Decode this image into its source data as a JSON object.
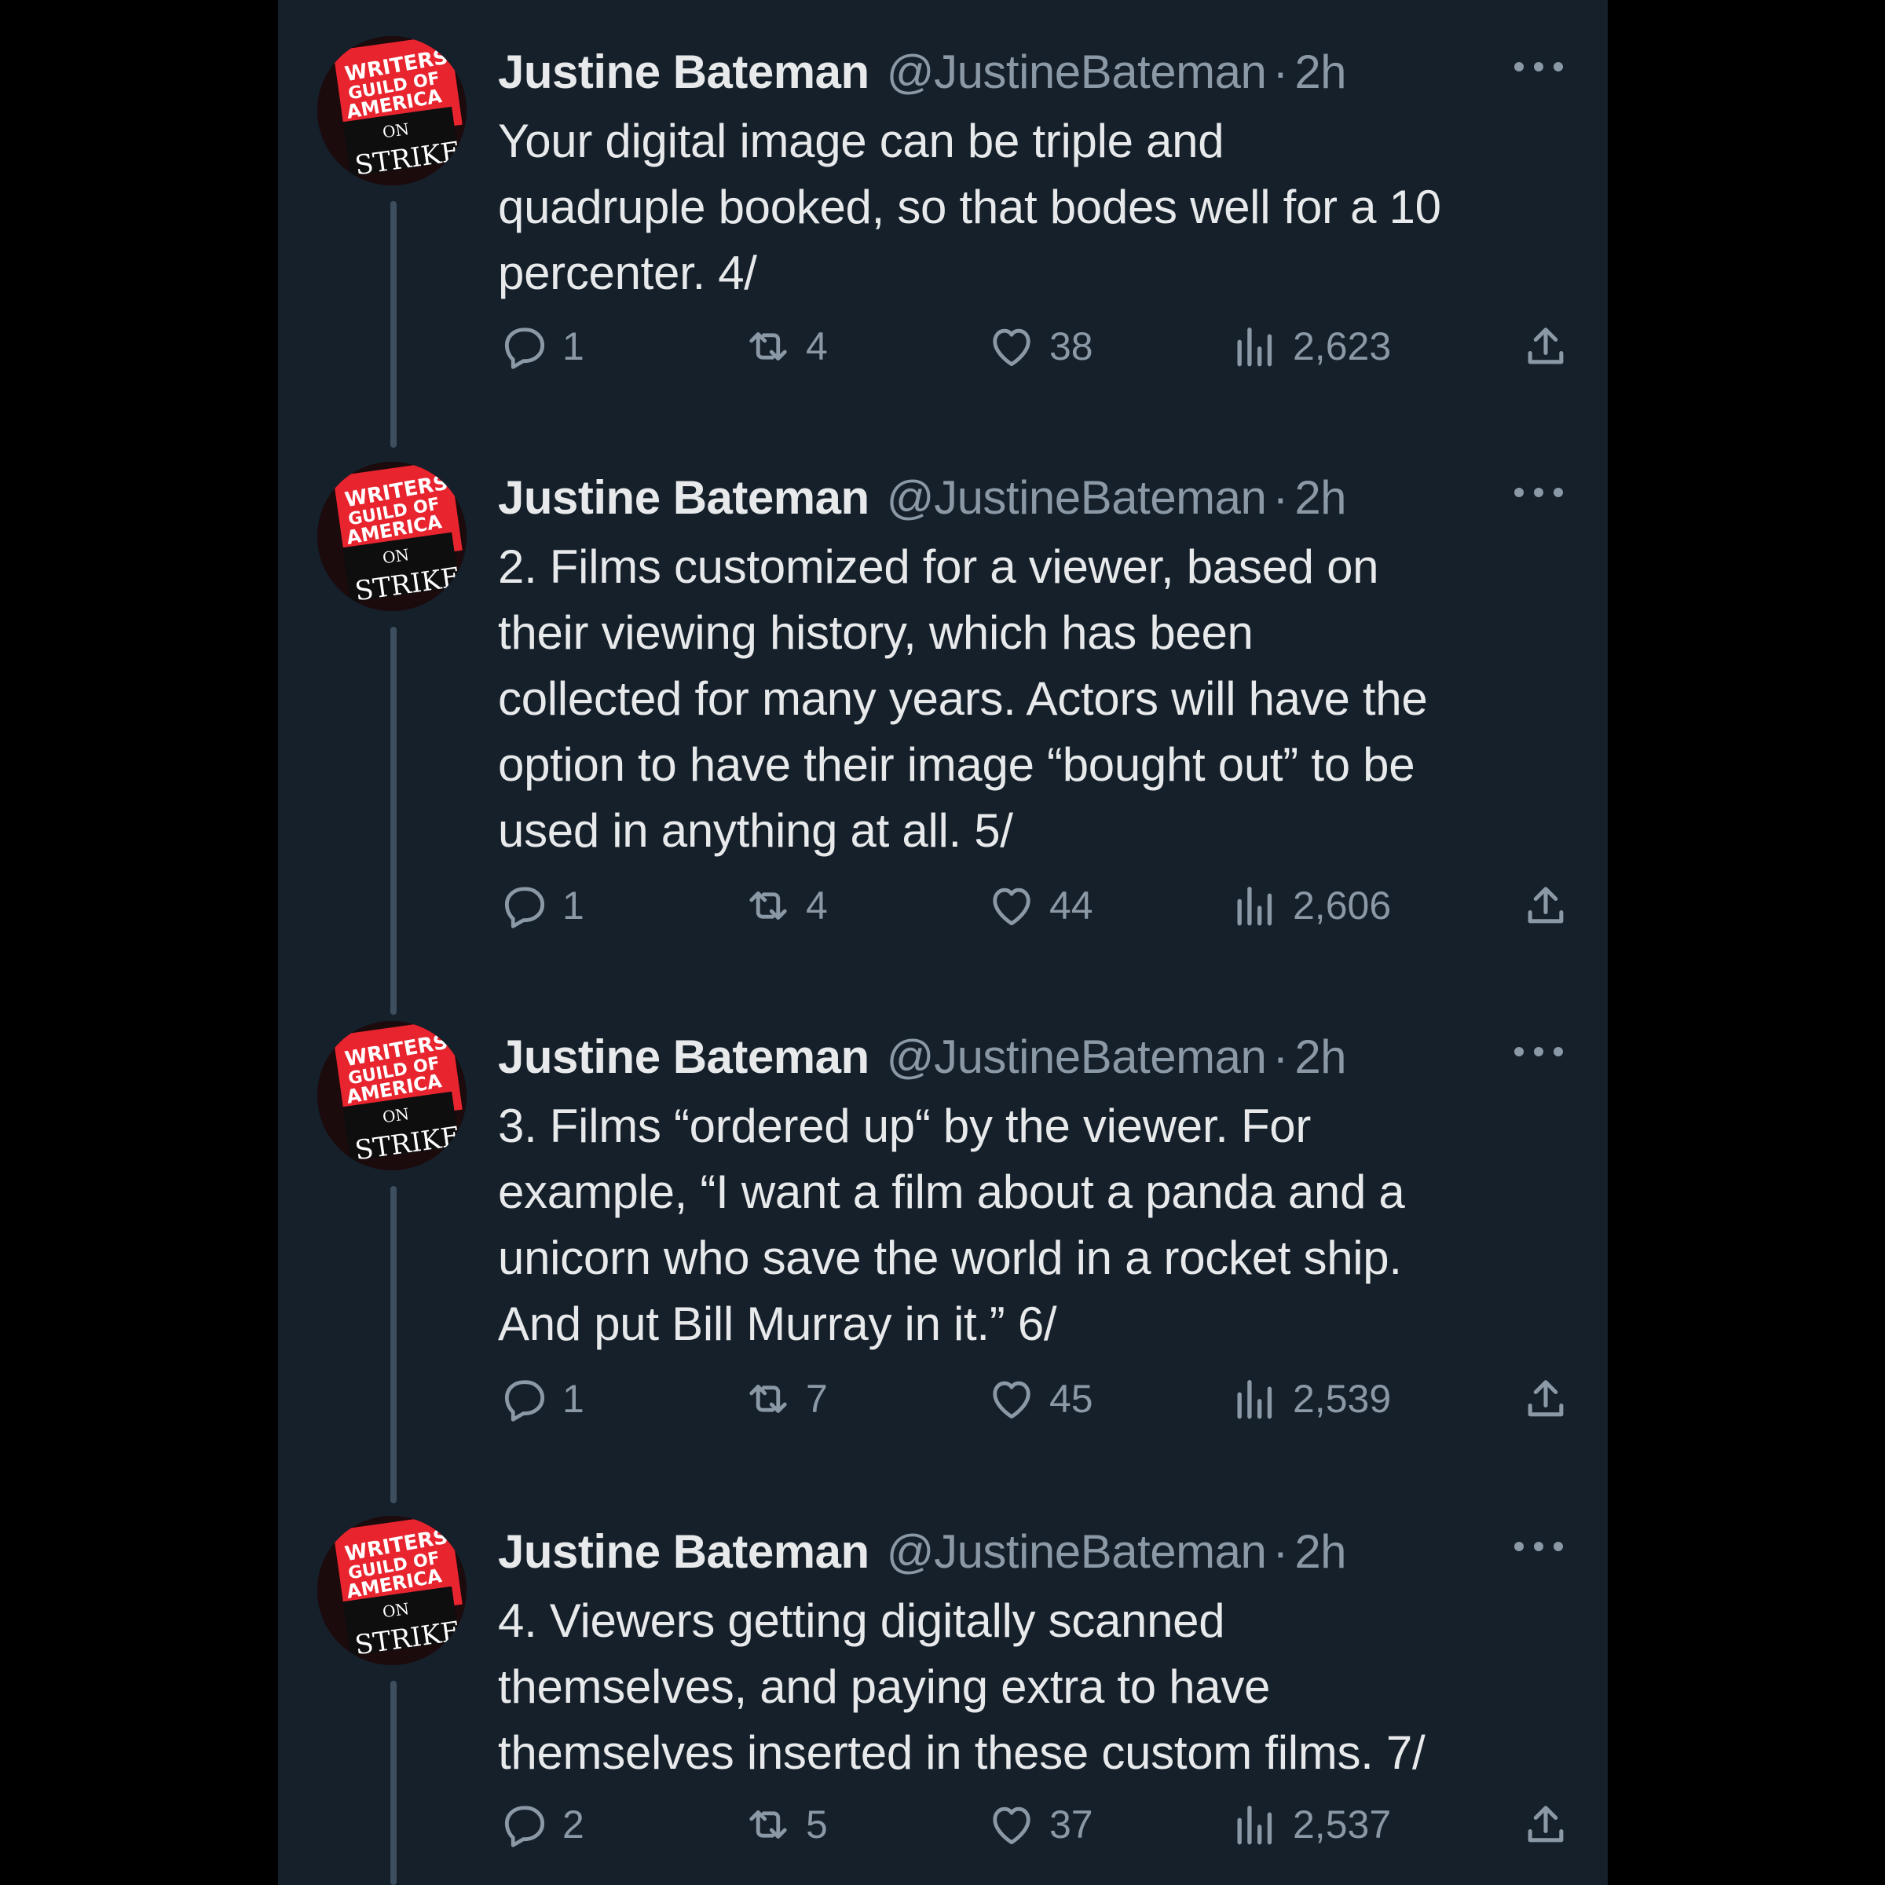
{
  "tweets": [
    {
      "author_name": "Justine Bateman",
      "handle": "@JustineBateman",
      "separator": "·",
      "time": "2h",
      "text": "Your digital image can be triple and\nquadruple booked, so that bodes well for a 10\npercenter. 4/",
      "replies": "1",
      "retweets": "4",
      "likes": "38",
      "views": "2,623"
    },
    {
      "author_name": "Justine Bateman",
      "handle": "@JustineBateman",
      "separator": "·",
      "time": "2h",
      "text": "2. Films customized for a viewer, based on\ntheir viewing history, which has been\ncollected for many years. Actors will have the\noption to have their image “bought out” to be\nused in anything at all. 5/",
      "replies": "1",
      "retweets": "4",
      "likes": "44",
      "views": "2,606"
    },
    {
      "author_name": "Justine Bateman",
      "handle": "@JustineBateman",
      "separator": "·",
      "time": "2h",
      "text": "3. Films “ordered up“ by the viewer. For\nexample, “I want a film about a panda and a\nunicorn who save the world in a rocket ship.\nAnd put Bill Murray in it.” 6/",
      "replies": "1",
      "retweets": "7",
      "likes": "45",
      "views": "2,539"
    },
    {
      "author_name": "Justine Bateman",
      "handle": "@JustineBateman",
      "separator": "·",
      "time": "2h",
      "text": "4. Viewers getting digitally scanned\nthemselves, and paying extra to have\nthemselves inserted in these custom films. 7/",
      "replies": "2",
      "retweets": "5",
      "likes": "37",
      "views": "2,537"
    }
  ],
  "avatar": {
    "sign_line1": "WRITERS",
    "sign_line2": "GUILD OF",
    "sign_line3": "AMERICA",
    "sign_line4": "ON",
    "sign_line5": "STRIKE"
  },
  "icons": {
    "reply": "reply-icon",
    "retweet": "retweet-icon",
    "like": "heart-icon",
    "views": "views-icon",
    "share": "share-icon",
    "more": "more-icon"
  },
  "colors": {
    "background": "#15202b",
    "text": "#e7e9ea",
    "secondary": "#8b98a5",
    "thread_line": "#3d4f5f",
    "sign_red": "#e8242f"
  }
}
